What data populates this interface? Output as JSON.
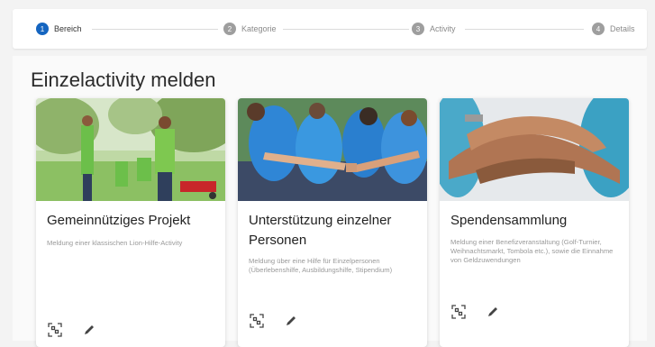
{
  "stepper": {
    "steps": [
      {
        "number": "1",
        "label": "Bereich",
        "active": true
      },
      {
        "number": "2",
        "label": "Kategorie",
        "active": false
      },
      {
        "number": "3",
        "label": "Activity",
        "active": false
      },
      {
        "number": "4",
        "label": "Details",
        "active": false
      }
    ]
  },
  "main": {
    "title": "Einzelactivity melden",
    "cards": [
      {
        "title": "Gemeinnütziges Projekt",
        "description": "Meldung einer klassischen Lion-Hilfe-Activity",
        "actions": [
          "qr-scan-icon",
          "pencil-icon"
        ]
      },
      {
        "title": "Unterstützung einzelner Personen",
        "description": "Meldung über eine Hilfe für Einzelpersonen (Überlebenshilfe, Ausbildungshilfe, Stipendium)",
        "actions": [
          "qr-scan-icon",
          "pencil-icon"
        ]
      },
      {
        "title": "Spendensammlung",
        "description": "Meldung einer Benefizveranstaltung (Golf-Turnier, Weihnachtsmarkt, Tombola etc.), sowie die Einnahme von Geldzuwendungen",
        "actions": [
          "qr-scan-icon",
          "pencil-icon"
        ]
      }
    ]
  },
  "colors": {
    "accent": "#1565c0",
    "inactive_step": "#9e9e9e",
    "background": "#f3f3f3"
  }
}
